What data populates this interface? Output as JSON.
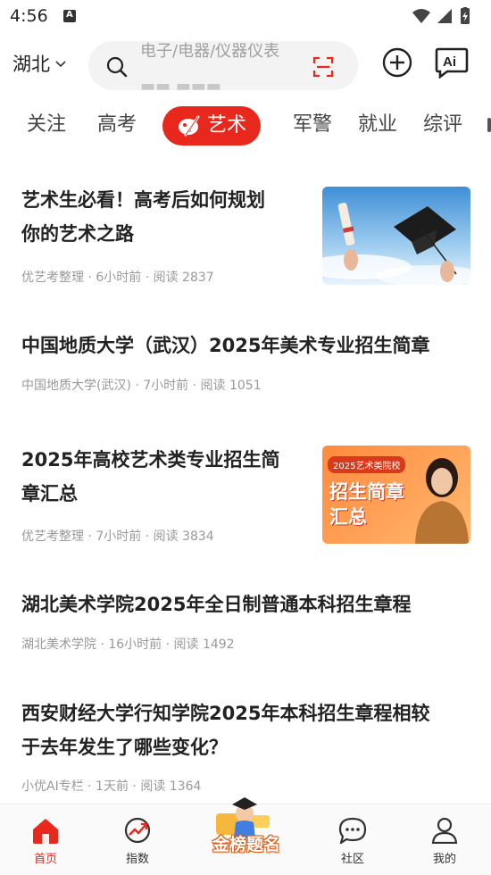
{
  "status_bar": {
    "time": "4:56",
    "notif_letter": "A"
  },
  "header": {
    "location": "湖北",
    "search_placeholder": "电子/电器/仪器仪表"
  },
  "tabs": [
    {
      "label": "关注"
    },
    {
      "label": "高考"
    },
    {
      "label": "艺术",
      "active": true
    },
    {
      "label": "军警"
    },
    {
      "label": "就业"
    },
    {
      "label": "综评"
    }
  ],
  "articles": [
    {
      "title_line1": "艺术生必看！高考后如何规划",
      "title_line2": "你的艺术之路",
      "meta": "优艺考整理 · 6小时前 · 阅读 2837",
      "thumb": "graduation-photo"
    },
    {
      "title_line1": "中国地质大学（武汉）2025年美术专业招生简章",
      "meta": "中国地质大学(武汉) · 7小时前 · 阅读 1051"
    },
    {
      "title_line1": "2025年高校艺术类专业招生简",
      "title_line2": "章汇总",
      "meta": "优艺考整理 · 7小时前 · 阅读 3834",
      "thumb": "admissions-banner",
      "thumb_badge": "2025艺术类院校",
      "thumb_line1": "招生简章",
      "thumb_line2": "汇总"
    },
    {
      "title_line1": "湖北美术学院2025年全日制普通本科招生章程",
      "meta": "湖北美术学院 · 16小时前 · 阅读 1492"
    },
    {
      "title_line1": "西安财经大学行知学院2025年本科招生章程相较",
      "title_line2": "于去年发生了哪些变化？",
      "meta": "小优AI专栏 · 1天前 · 阅读 1364"
    }
  ],
  "bottom_nav": {
    "home": "首页",
    "index": "指数",
    "center_badge": "金榜题名",
    "community": "社区",
    "mine": "我的"
  },
  "colors": {
    "accent": "#e8271d"
  }
}
